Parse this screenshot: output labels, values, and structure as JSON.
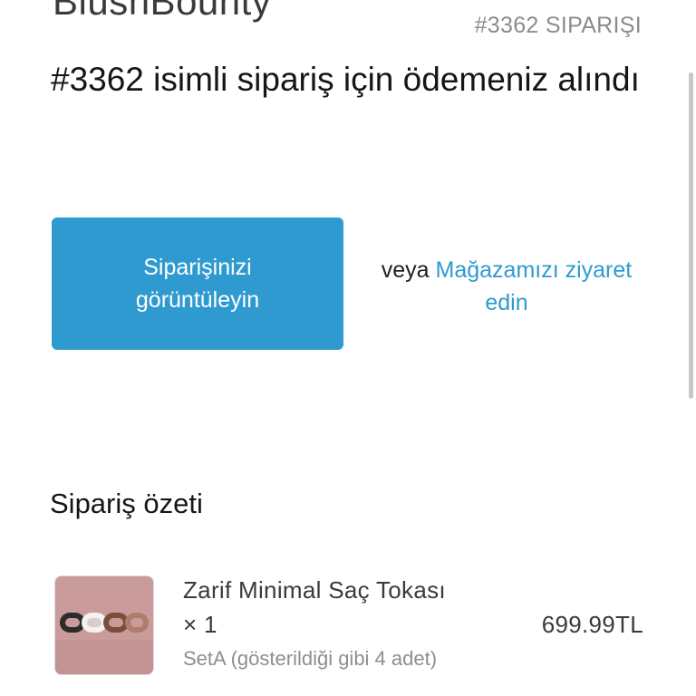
{
  "header": {
    "brand": "BlushBounty",
    "order_tag": "#3362 SIPARIŞI"
  },
  "headline": "#3362 isimli sipariş için ödemeniz alındı",
  "actions": {
    "view_order_label": "Siparişinizi görüntüleyin",
    "or_word": "veya",
    "visit_store_label": "Mağazamızı ziyaret edin"
  },
  "summary": {
    "title": "Sipariş özeti",
    "items": [
      {
        "name": "Zarif Minimal Saç Tokası × 1",
        "variant": "SetA (gösterildiği gibi 4 adet)",
        "price": "699.99TL",
        "image_icon": "hair-clips-photo"
      }
    ]
  },
  "colors": {
    "accent": "#2f9ad0",
    "text": "#161616",
    "muted": "#8c8c8c",
    "thumb_bg": "#c99b9b"
  }
}
